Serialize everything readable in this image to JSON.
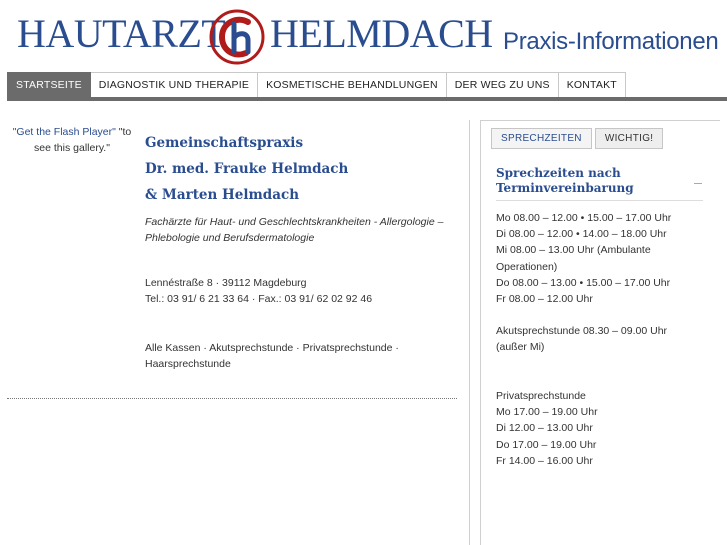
{
  "header": {
    "logo_left": "HAUTARZT",
    "logo_right": "HELMDACH",
    "subtitle": "Praxis-Informationen"
  },
  "nav": {
    "items": [
      {
        "label": "STARTSEITE",
        "active": true
      },
      {
        "label": "DIAGNOSTIK UND THERAPIE",
        "active": false
      },
      {
        "label": "KOSMETISCHE BEHANDLUNGEN",
        "active": false
      },
      {
        "label": "DER WEG ZU UNS",
        "active": false
      },
      {
        "label": "KONTAKT",
        "active": false
      }
    ]
  },
  "flash": {
    "link": "\"Get the Flash Player\"",
    "rest": " \"to see this gallery.\""
  },
  "main": {
    "title_lines": [
      "Gemeinschaftspraxis",
      "Dr. med. Frauke Helmdach",
      "& Marten Helmdach"
    ],
    "specialty": "Fachärzte für Haut- und Geschlechtskrankheiten - Allergologie – Phlebologie und Berufsdermatologie",
    "address": "Lennéstraße 8  · 39112 Magdeburg",
    "phone": "Tel.: 03 91/ 6 21 33 64 · Fax.: 03 91/ 62 02 92 46",
    "insurance": "Alle Kassen · Akutsprechstunde · Privatsprechstunde · Haarsprechstunde"
  },
  "sidebar": {
    "tabs": [
      {
        "label": "SPRECHZEITEN",
        "active": true
      },
      {
        "label": "WICHTIG!",
        "active": false
      }
    ],
    "title": "Sprechzeiten nach Terminvereinbarung",
    "hours": [
      "Mo  08.00 – 12.00 • 15.00 – 17.00 Uhr",
      "Di    08.00 – 12.00 • 14.00 – 18.00 Uhr",
      "Mi   08.00 – 13.00  Uhr (Ambulante",
      "Operationen)",
      "Do   08.00 – 13.00 • 15.00 – 17.00 Uhr",
      "Fr    08.00 – 12.00 Uhr"
    ],
    "akut": [
      "Akutsprechstunde  08.30 – 09.00 Uhr",
      "(außer Mi)"
    ],
    "privat": [
      "Privatsprechstunde",
      "Mo 17.00 – 19.00 Uhr",
      "Di   12.00 – 13.00 Uhr",
      "Do  17.00 – 19.00 Uhr",
      "Fr   14.00 – 16.00 Uhr"
    ]
  },
  "colors": {
    "brand_blue": "#2a4d8f",
    "logo_red": "#b01c1c",
    "nav_active": "#6b6b6b"
  }
}
